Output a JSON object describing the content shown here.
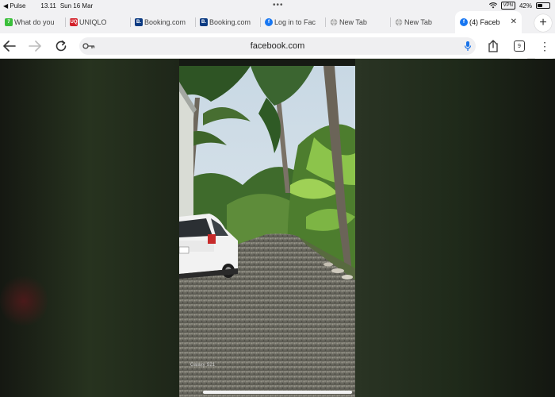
{
  "status": {
    "back_app": "◀ Pulse",
    "time": "13.11",
    "date": "Sun 16 Mar",
    "vpn": "VPN",
    "battery": "42%",
    "battery_level": 0.42
  },
  "tabs": [
    {
      "label": "What do you",
      "icon": "leaf-favicon",
      "color": "#3bbf3b",
      "glyph": "7"
    },
    {
      "label": "UNIQLO",
      "icon": "uniqlo-favicon",
      "color": "#d3202a",
      "glyph": "UQ"
    },
    {
      "label": "Booking.com",
      "icon": "booking-favicon",
      "color": "#0b3a82",
      "glyph": "B."
    },
    {
      "label": "Booking.com",
      "icon": "booking-favicon",
      "color": "#0b3a82",
      "glyph": "B."
    },
    {
      "label": "Log in to Fac",
      "icon": "facebook-favicon",
      "color": "#1877f2",
      "glyph": "f"
    },
    {
      "label": "New Tab",
      "icon": "globe-favicon",
      "color": "#9a9a9a",
      "glyph": ""
    },
    {
      "label": "New Tab",
      "icon": "globe-favicon",
      "color": "#9a9a9a",
      "glyph": ""
    },
    {
      "label": "(4) Faceb",
      "icon": "facebook-favicon",
      "color": "#1877f2",
      "glyph": "f",
      "active": true
    }
  ],
  "toolbar": {
    "url": "facebook.com",
    "tab_count": "9"
  },
  "photo": {
    "watermark": "Galaxy S21"
  },
  "colors": {
    "accent": "#1877f2",
    "chrome_bg": "#f1f1f3"
  }
}
